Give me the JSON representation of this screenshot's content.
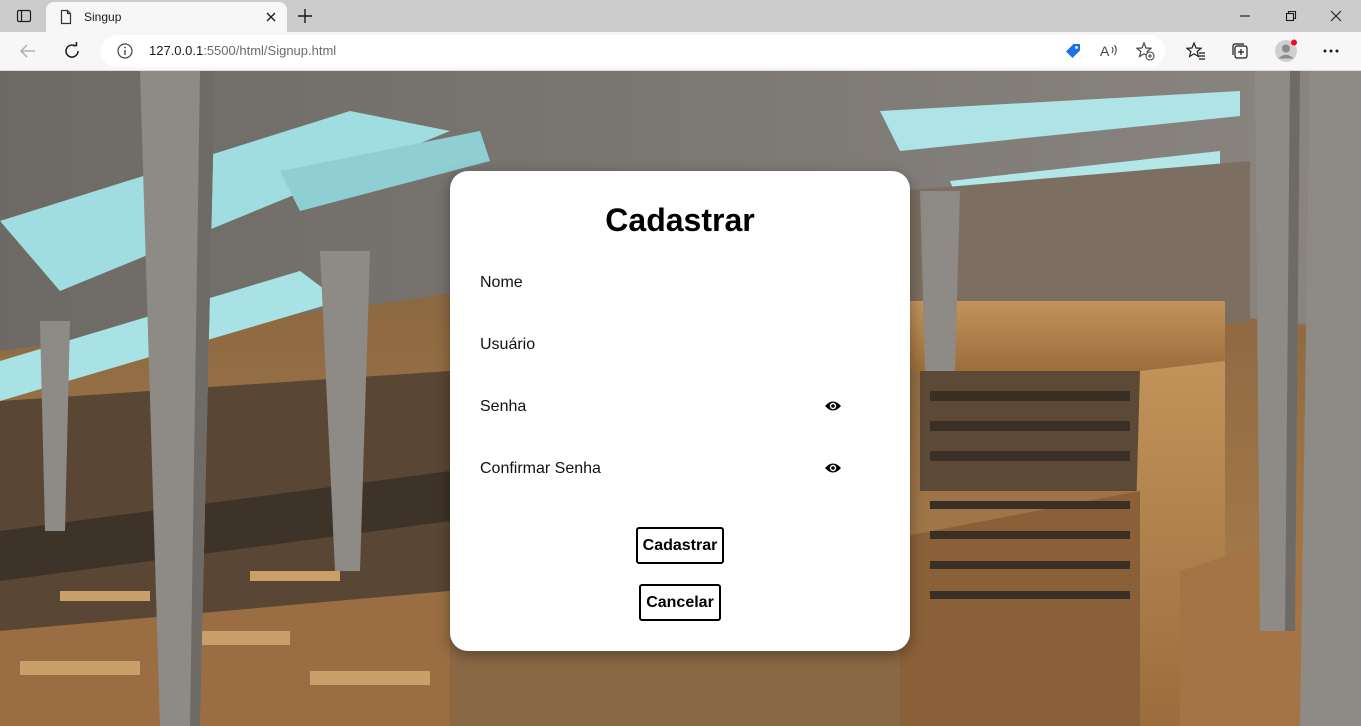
{
  "browser": {
    "tab_title": "Singup",
    "url_host": "127.0.0.1",
    "url_rest": ":5500/html/Signup.html"
  },
  "form": {
    "title": "Cadastrar",
    "fields": [
      {
        "label": "Nome"
      },
      {
        "label": "Usuário"
      },
      {
        "label": "Senha"
      },
      {
        "label": "Confirmar Senha"
      }
    ],
    "submit_label": "Cadastrar",
    "cancel_label": "Cancelar"
  },
  "icons": {
    "tab_actions": "tab-actions-icon",
    "favicon": "page-icon",
    "close": "close-icon",
    "new_tab": "plus-icon",
    "minimize": "minimize-icon",
    "restore": "restore-icon",
    "window_close": "close-icon",
    "back": "arrow-left-icon",
    "refresh": "refresh-icon",
    "info": "info-icon",
    "shopping": "tag-icon",
    "read_aloud": "read-aloud-icon",
    "add_favorite": "star-plus-icon",
    "favorites": "favorites-icon",
    "collections": "collections-icon",
    "profile": "avatar",
    "more": "more-icon",
    "eye": "eye-icon"
  },
  "colors": {
    "tabbar": "#cccccc",
    "toolbar": "#f7f7f7",
    "shopping_icon": "#1a73e8",
    "profile_badge": "#e81123"
  }
}
